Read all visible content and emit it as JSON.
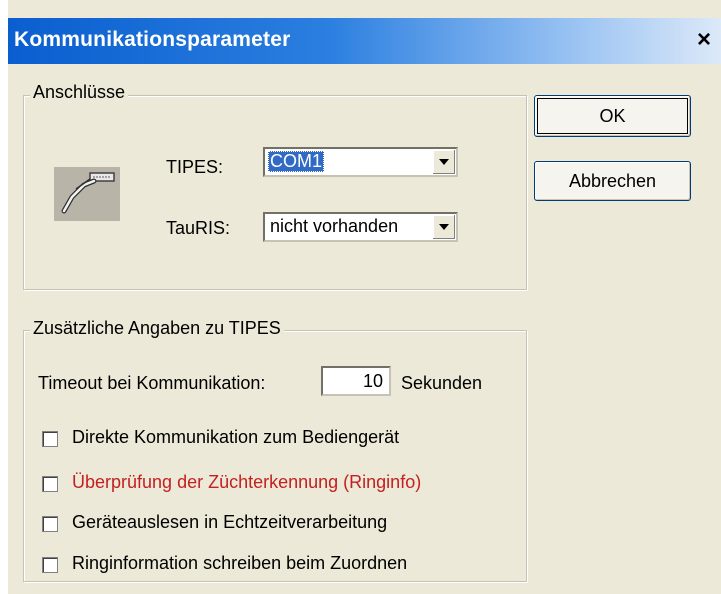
{
  "window": {
    "title": "Kommunikationsparameter",
    "close_label": "×"
  },
  "buttons": {
    "ok_label": "OK",
    "cancel_label": "Abbrechen"
  },
  "connections": {
    "legend": "Anschlüsse",
    "icon": "serial-cable-icon",
    "tipes_label": "TIPES:",
    "tipes_value": "COM1",
    "tauris_label": "TauRIS:",
    "tauris_value": "nicht vorhanden"
  },
  "tipes_extra": {
    "legend": "Zusätzliche Angaben zu TIPES",
    "timeout_label": "Timeout bei Kommunikation:",
    "timeout_value": "10",
    "timeout_unit": "Sekunden",
    "checkboxes": [
      {
        "label": "Direkte Kommunikation zum Bediengerät",
        "checked": false,
        "color": "#000000"
      },
      {
        "label": "Überprüfung der Züchterkennung (Ringinfo)",
        "checked": false,
        "color": "#c42020"
      },
      {
        "label": "Geräteauslesen in Echtzeitverarbeitung",
        "checked": false,
        "color": "#000000"
      },
      {
        "label": "Ringinformation schreiben beim Zuordnen",
        "checked": false,
        "color": "#000000"
      }
    ]
  },
  "colors": {
    "titlebar_start": "#0a5ecf",
    "dialog_bg": "#ece9d8",
    "selection": "#316ac5",
    "warning_text": "#c42020"
  }
}
